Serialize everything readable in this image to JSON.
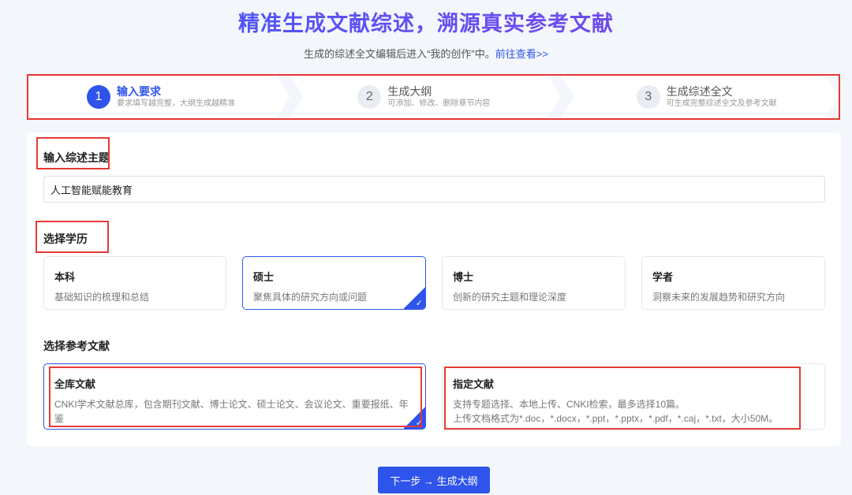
{
  "hero": {
    "title": "精准生成文献综述，溯源真实参考文献",
    "subtitle": "生成的综述全文编辑后进入“我的创作”中。",
    "subtitle_link": "前往查看>>"
  },
  "steps": [
    {
      "num": "1",
      "title": "输入要求",
      "desc": "要求填写越完整，大纲生成越精准",
      "active": true
    },
    {
      "num": "2",
      "title": "生成大纲",
      "desc": "可添加、修改、删除章节内容",
      "active": false
    },
    {
      "num": "3",
      "title": "生成综述全文",
      "desc": "可生成完整综述全文及参考文献",
      "active": false
    }
  ],
  "topic": {
    "label": "输入综述主题",
    "value": "人工智能赋能教育"
  },
  "degree": {
    "label": "选择学历",
    "options": [
      {
        "title": "本科",
        "desc": "基础知识的梳理和总结",
        "selected": false
      },
      {
        "title": "硕士",
        "desc": "聚焦具体的研究方向或问题",
        "selected": true
      },
      {
        "title": "博士",
        "desc": "创新的研究主题和理论深度",
        "selected": false
      },
      {
        "title": "学者",
        "desc": "洞察未来的发展趋势和研究方向",
        "selected": false
      }
    ]
  },
  "reference": {
    "label": "选择参考文献",
    "options": [
      {
        "title": "全库文献",
        "desc": "CNKI学术文献总库，包含期刊文献、博士论文、硕士论文、会议论文、重要报纸、年鉴",
        "selected": true
      },
      {
        "title": "指定文献",
        "desc": "支持专题选择、本地上传、CNKI检索，最多选择10篇。",
        "desc2": "上传文档格式为*.doc，*.docx，*.ppt，*.pptx，*.pdf，*.caj，*.txt，大小50M。",
        "selected": false
      }
    ]
  },
  "next_button": "下一步 → 生成大纲",
  "colors": {
    "accent": "#2f54eb",
    "annotation": "#e53935"
  }
}
